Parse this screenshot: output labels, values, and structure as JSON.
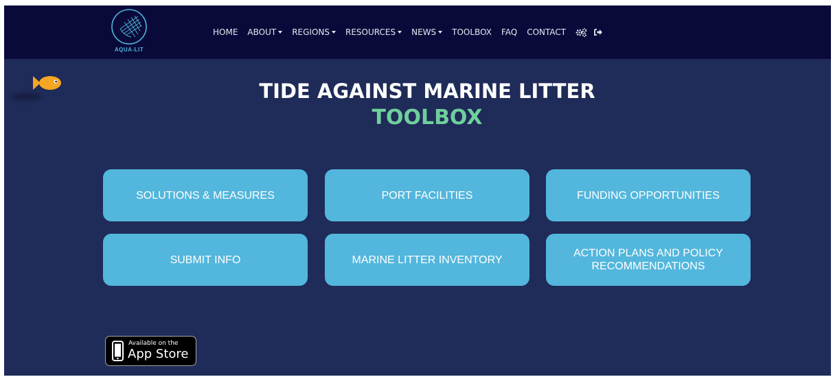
{
  "brand": {
    "logo_text": "AQUA-LIT",
    "accent_color": "#4fb6d9"
  },
  "nav": {
    "items": [
      {
        "label": "HOME",
        "dropdown": false
      },
      {
        "label": "ABOUT",
        "dropdown": true
      },
      {
        "label": "REGIONS",
        "dropdown": true
      },
      {
        "label": "RESOURCES",
        "dropdown": true
      },
      {
        "label": "NEWS",
        "dropdown": true
      },
      {
        "label": "TOOLBOX",
        "dropdown": false
      },
      {
        "label": "FAQ",
        "dropdown": false
      },
      {
        "label": "CONTACT",
        "dropdown": false
      }
    ],
    "icons": [
      "gears-icon",
      "sign-out-icon"
    ]
  },
  "hero": {
    "title": "TIDE AGAINST MARINE LITTER",
    "subtitle": "TOOLBOX",
    "subtitle_color": "#6fcf9d"
  },
  "tiles": [
    {
      "label": "SOLUTIONS & MEASURES"
    },
    {
      "label": "PORT FACILITIES"
    },
    {
      "label": "FUNDING OPPORTUNITIES"
    },
    {
      "label": "SUBMIT INFO"
    },
    {
      "label": "MARINE LITTER INVENTORY"
    },
    {
      "label": "ACTION PLANS AND POLICY RECOMMENDATIONS"
    }
  ],
  "appstore": {
    "line1": "Available on the",
    "line2": "App Store"
  },
  "colors": {
    "navbar_bg": "#0a0a3a",
    "page_bg": "#1f2b58",
    "tile_bg": "#53b6dc",
    "fish": "#f5a623"
  }
}
